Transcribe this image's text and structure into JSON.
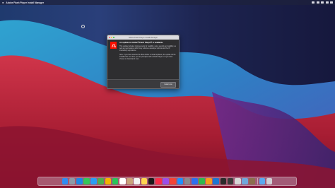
{
  "menubar": {
    "app_name": "Adobe Flash Player Install Manager",
    "status_icons": [
      "wifi-icon",
      "battery-icon",
      "search-icon",
      "control-center-icon",
      "siri-icon"
    ],
    "clock": ""
  },
  "dialog": {
    "title": "Adobe Flash Player Install Manager",
    "logo": "adobe-logo",
    "headline": "An update to Adobe® Flash Player® is available.",
    "paragraph1": "This update includes improvements for usability, some security and stability, as well as new features which may enhance developer options and the IP interactivity experience.",
    "paragraph2": "Note: If you have selected to allow Adobe to install updates, this update will be installed the next time you are prompted with a Flash Player or if you have chosen to download it now.",
    "button_label": "Install now"
  },
  "dock": {
    "apps": [
      {
        "name": "finder-icon",
        "color": "#2f8cf2"
      },
      {
        "name": "launchpad-icon",
        "color": "#8e9aa6"
      },
      {
        "name": "safari-icon",
        "color": "#1e88e5"
      },
      {
        "name": "messages-icon",
        "color": "#34c759"
      },
      {
        "name": "mail-icon",
        "color": "#2a9df4"
      },
      {
        "name": "maps-icon",
        "color": "#4caf50"
      },
      {
        "name": "photos-icon",
        "color": "#f4b400"
      },
      {
        "name": "facetime-icon",
        "color": "#29c45a"
      },
      {
        "name": "calendar-icon",
        "color": "#ffffff"
      },
      {
        "name": "contacts-icon",
        "color": "#c9a27a"
      },
      {
        "name": "reminders-icon",
        "color": "#f2f2f2"
      },
      {
        "name": "notes-icon",
        "color": "#ffd54f"
      },
      {
        "name": "tv-icon",
        "color": "#1a1a1a"
      },
      {
        "name": "music-icon",
        "color": "#fa2d48"
      },
      {
        "name": "podcasts-icon",
        "color": "#9b4dea"
      },
      {
        "name": "news-icon",
        "color": "#f44336"
      },
      {
        "name": "app-store-icon",
        "color": "#1e90ff"
      },
      {
        "name": "system-preferences-icon",
        "color": "#8a8a8e"
      },
      {
        "name": "keynote-icon",
        "color": "#2d6ff0"
      },
      {
        "name": "numbers-icon",
        "color": "#2fb84d"
      },
      {
        "name": "pages-icon",
        "color": "#f59c1a"
      },
      {
        "name": "xcode-icon",
        "color": "#1c76d2"
      },
      {
        "name": "terminal-icon",
        "color": "#2b2b2b"
      },
      {
        "name": "activity-monitor-icon",
        "color": "#3a3a3a"
      },
      {
        "name": "script-editor-icon",
        "color": "#d7d7d7"
      },
      {
        "name": "preview-icon",
        "color": "#6fa8dc"
      },
      {
        "name": "installer-icon",
        "color": "#8b6f4e"
      }
    ],
    "trailing": [
      {
        "name": "downloads-folder-icon",
        "color": "#5aa9f0"
      },
      {
        "name": "trash-icon",
        "color": "#d0d0d6"
      }
    ]
  }
}
